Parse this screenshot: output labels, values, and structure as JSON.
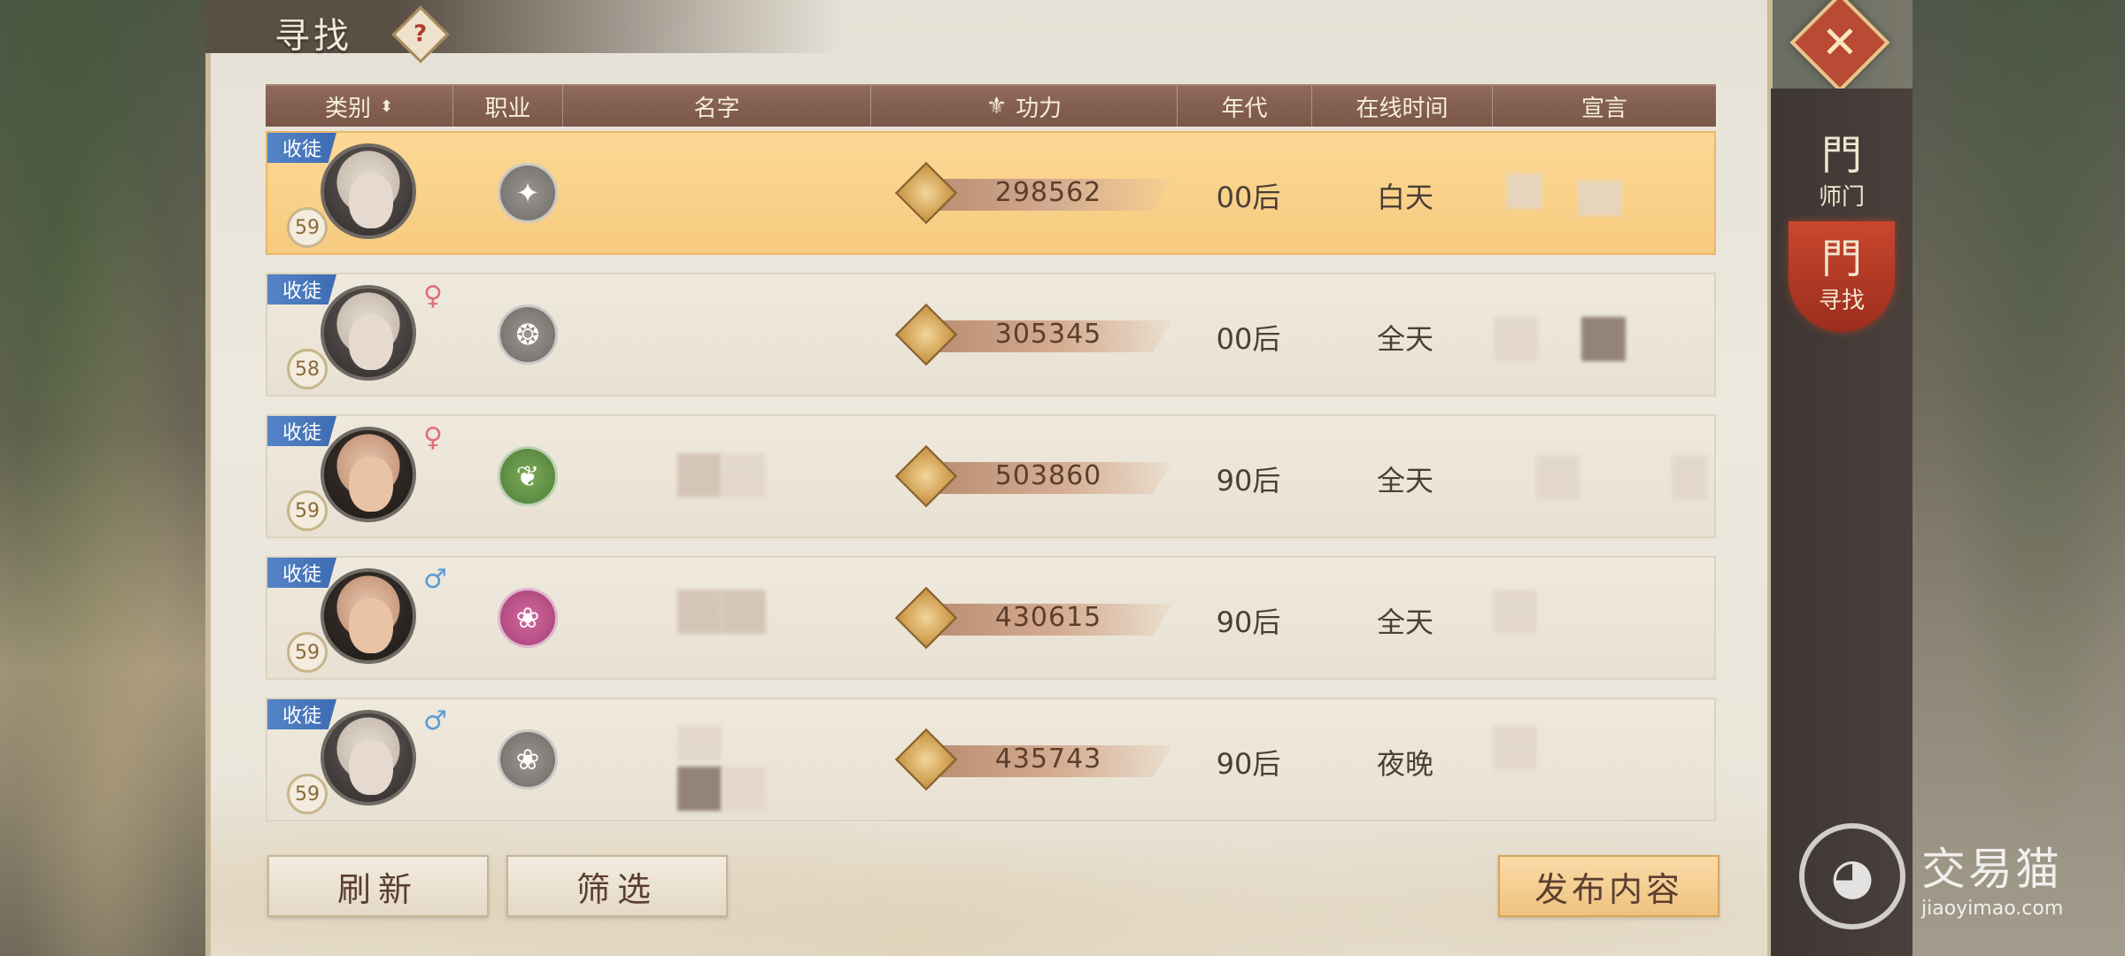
{
  "window": {
    "title": "寻找",
    "help_glyph": "?",
    "close_glyph": "✕"
  },
  "sidebar": {
    "tabs": [
      {
        "label": "师门",
        "glyph": "門",
        "active": false
      },
      {
        "label": "寻找",
        "glyph": "門",
        "active": true
      }
    ]
  },
  "table": {
    "headers": [
      {
        "label": "类别",
        "sortable": true
      },
      {
        "label": "职业"
      },
      {
        "label": "名字"
      },
      {
        "label": "功力",
        "icon": "power-icon"
      },
      {
        "label": "年代"
      },
      {
        "label": "在线时间"
      },
      {
        "label": "宣言"
      }
    ],
    "rows": [
      {
        "tag": "收徒",
        "level": "59",
        "gender": "",
        "job_icon": "sword-fan-icon",
        "job_color": "grey",
        "power": "298562",
        "era": "00后",
        "online": "白天",
        "selected": true
      },
      {
        "tag": "收徒",
        "level": "58",
        "gender": "♀",
        "job_icon": "fan-icon",
        "job_color": "grey",
        "power": "305345",
        "era": "00后",
        "online": "全天",
        "selected": false
      },
      {
        "tag": "收徒",
        "level": "59",
        "gender": "♀",
        "job_icon": "bamboo-icon",
        "job_color": "green",
        "power": "503860",
        "era": "90后",
        "online": "全天",
        "selected": false
      },
      {
        "tag": "收徒",
        "level": "59",
        "gender": "♂",
        "job_icon": "lotus-icon",
        "job_color": "pink",
        "power": "430615",
        "era": "90后",
        "online": "全天",
        "selected": false
      },
      {
        "tag": "收徒",
        "level": "59",
        "gender": "♂",
        "job_icon": "lotus-icon",
        "job_color": "grey",
        "power": "435743",
        "era": "90后",
        "online": "夜晚",
        "selected": false
      }
    ]
  },
  "buttons": {
    "refresh": "刷新",
    "filter": "筛选",
    "publish": "发布内容"
  },
  "watermark": {
    "name": "交易猫",
    "url": "jiaoyimao.com"
  },
  "colors": {
    "header": "#7a5648",
    "selected_row": "#f7cb80",
    "tag_blue": "#3e6cb3",
    "accent_red": "#b94a33"
  }
}
